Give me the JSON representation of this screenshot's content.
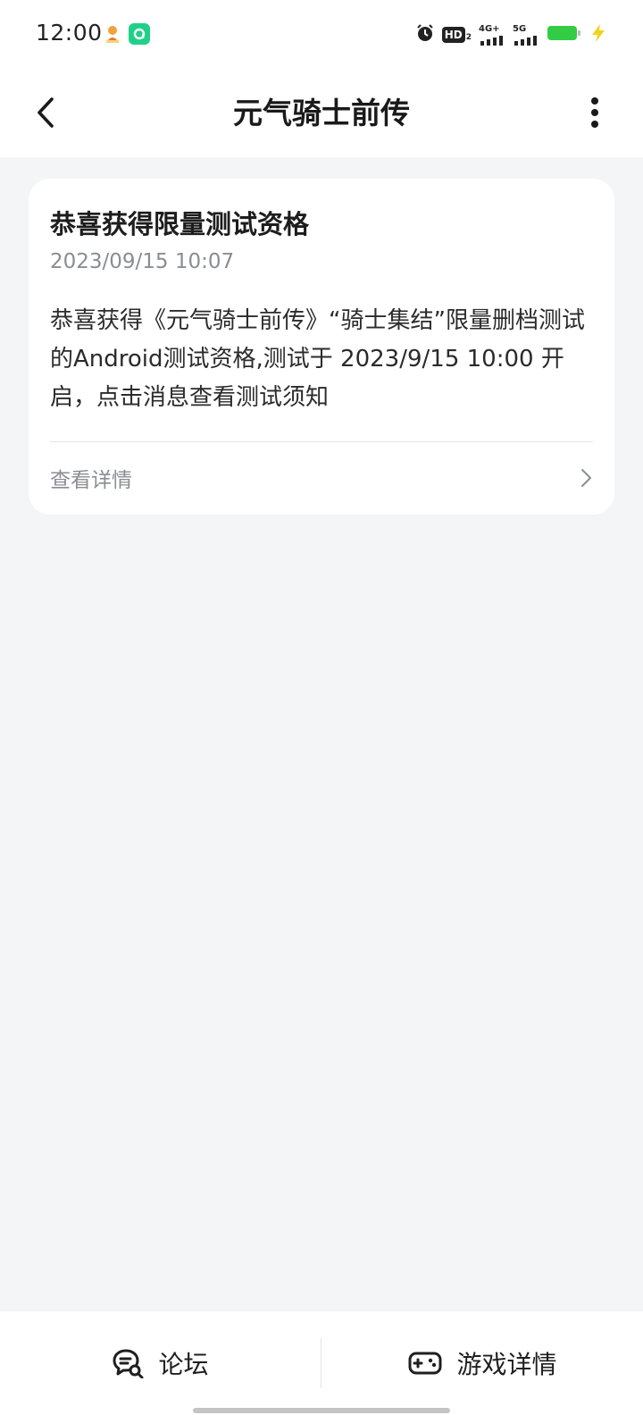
{
  "status_bar": {
    "time": "12:00",
    "network_1": "4G+",
    "network_2": "5G",
    "hd_label": "HD",
    "icons": [
      "app-notification-icon",
      "app-icon",
      "alarm-icon",
      "hd-icon",
      "signal-icon",
      "battery-icon",
      "charging-icon"
    ],
    "battery_color": "#33cc44"
  },
  "header": {
    "title": "元气骑士前传",
    "back_icon": "back-icon",
    "more_icon": "more-icon"
  },
  "message_card": {
    "title": "恭喜获得限量测试资格",
    "timestamp": "2023/09/15 10:07",
    "body": "恭喜获得《元气骑士前传》“骑士集结”限量删档测试的Android测试资格,测试于 2023/9/15 10:00 开启，点击消息查看测试须知",
    "detail_label": "查看详情",
    "detail_icon": "chevron-right-icon"
  },
  "bottom_bar": {
    "forum_label": "论坛",
    "forum_icon": "forum-icon",
    "game_detail_label": "游戏详情",
    "game_detail_icon": "gamepad-icon"
  }
}
